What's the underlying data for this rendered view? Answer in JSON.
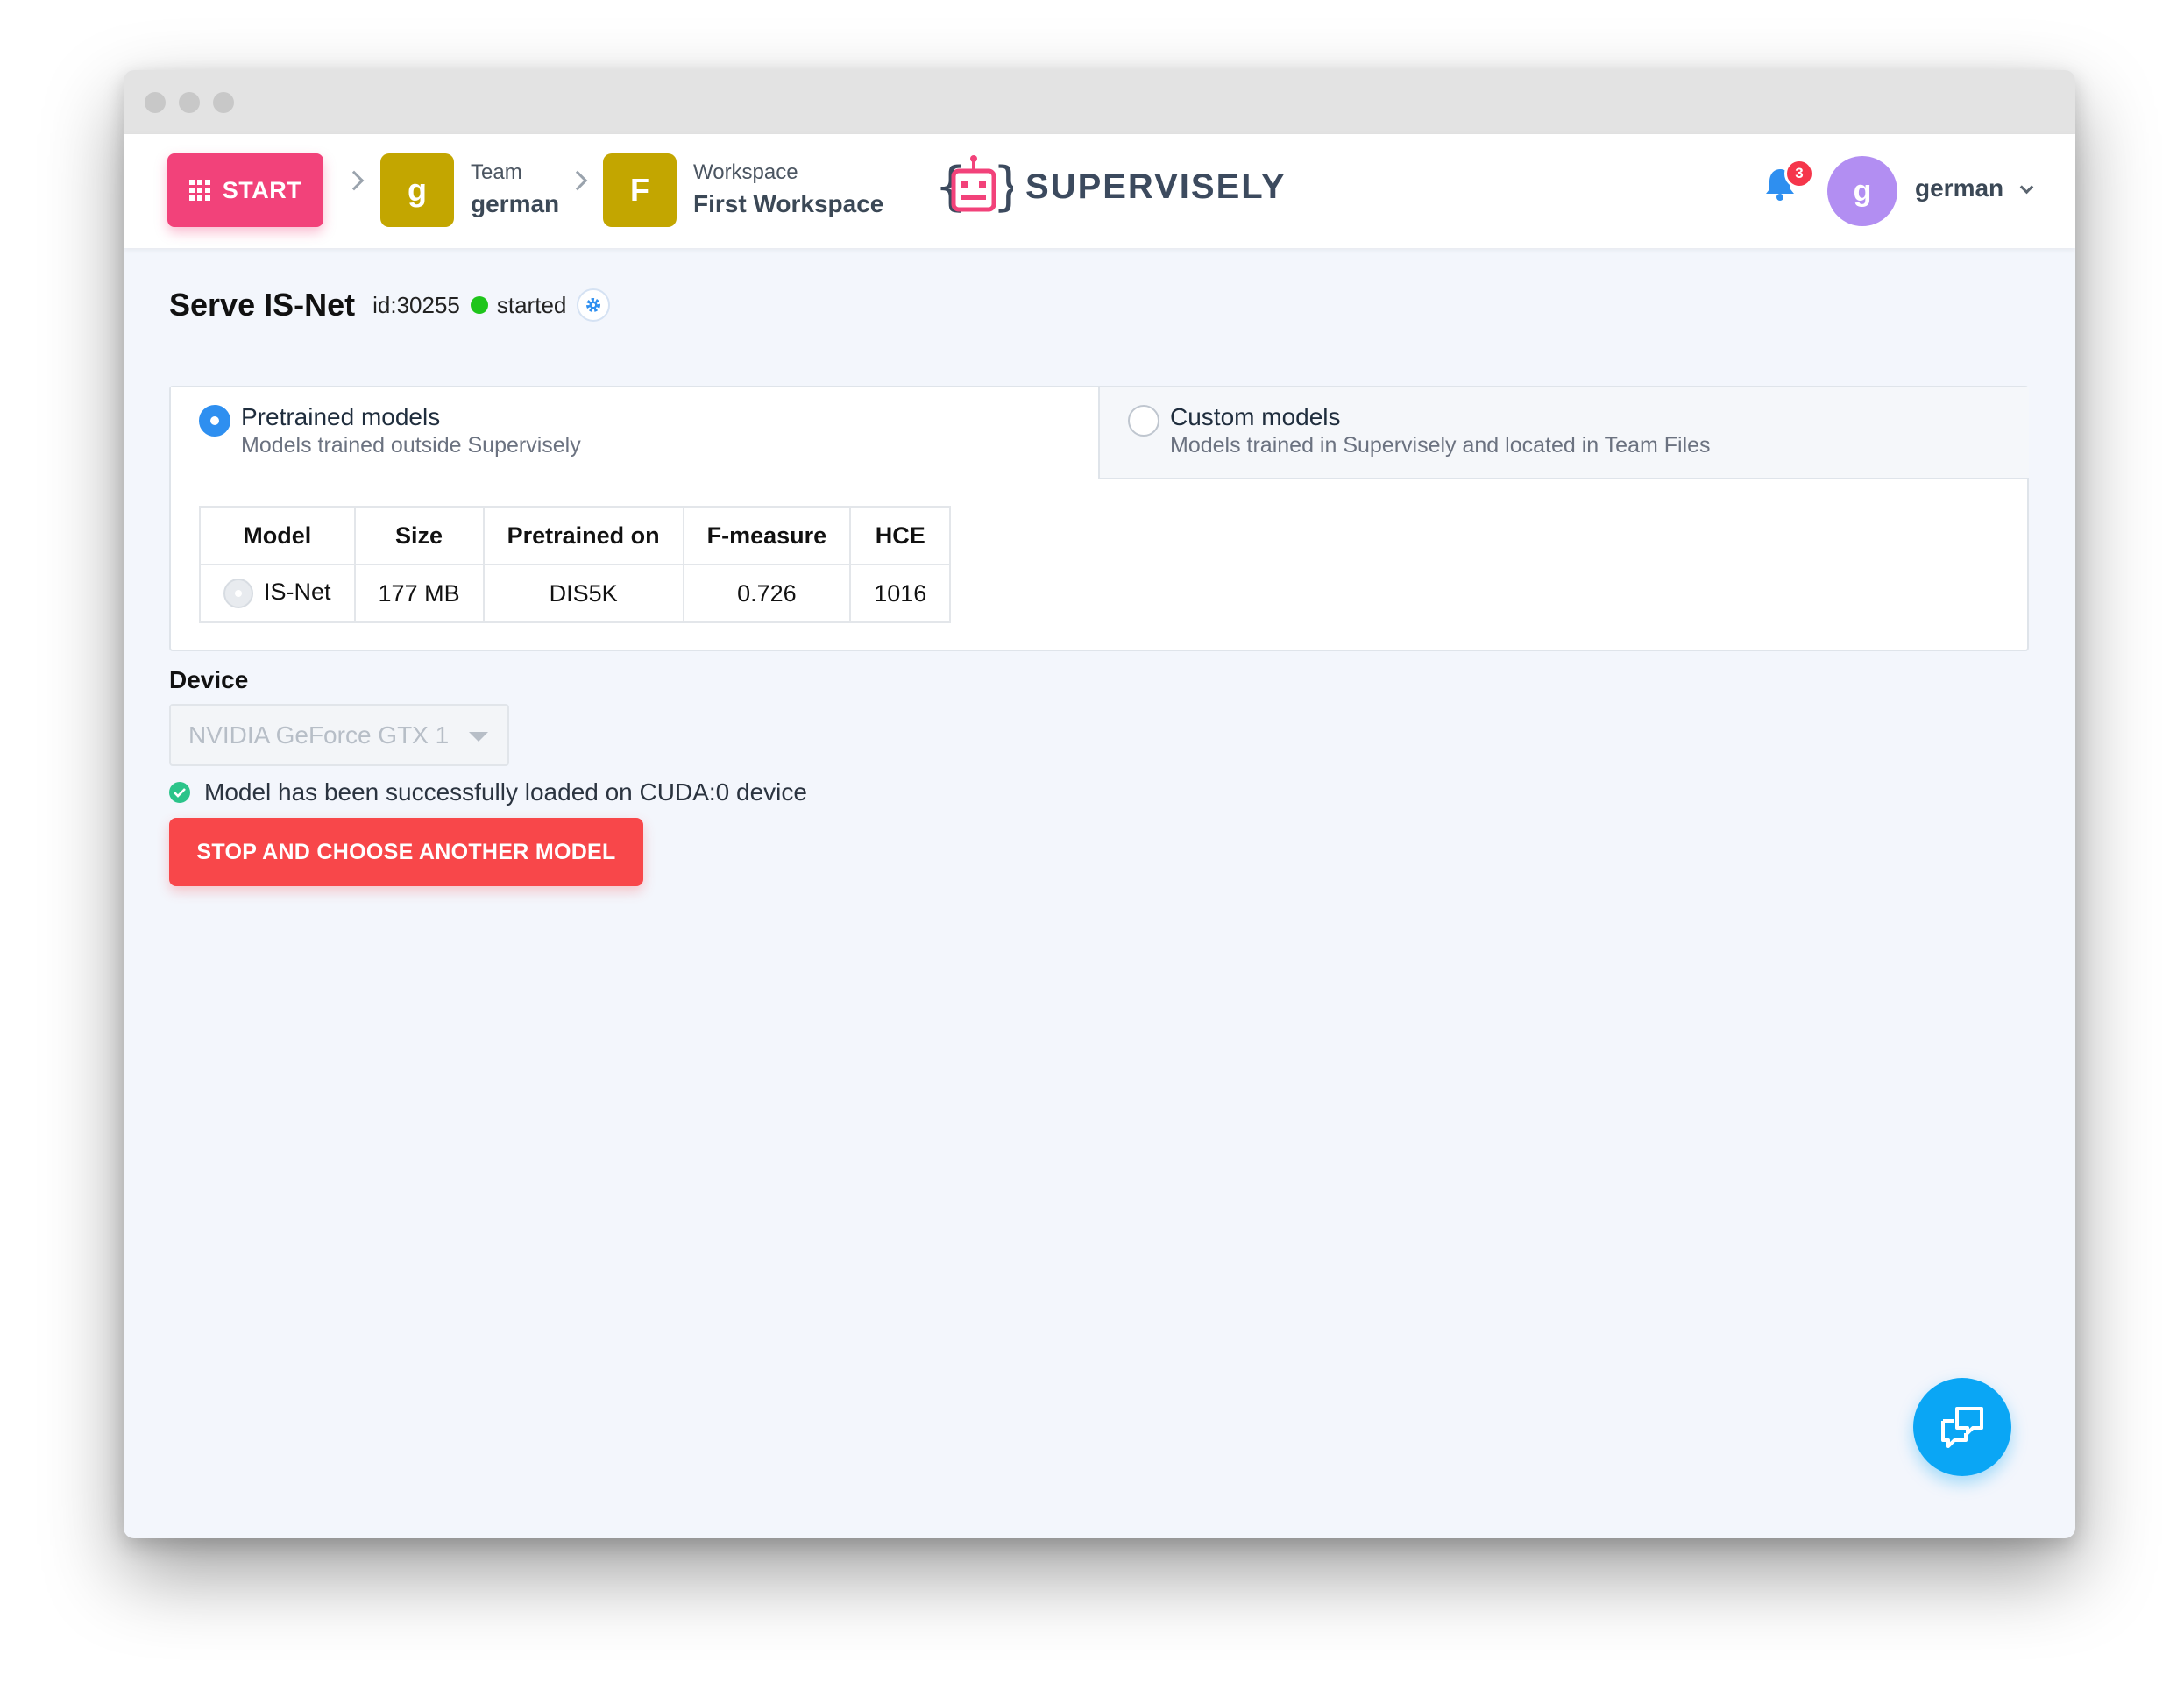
{
  "header": {
    "start_label": "START",
    "team": {
      "avatar_letter": "g",
      "label": "Team",
      "value": "german"
    },
    "workspace": {
      "avatar_letter": "F",
      "label": "Workspace",
      "value": "First Workspace"
    },
    "logo_text": "SUPERVISELY",
    "notifications_count": "3",
    "user": {
      "avatar_letter": "g",
      "name": "german"
    }
  },
  "app": {
    "title": "Serve IS-Net",
    "id": "id:30255",
    "status": "started",
    "status_color": "#1ec51b"
  },
  "tabs": [
    {
      "title": "Pretrained models",
      "subtitle": "Models trained outside Supervisely",
      "selected": true
    },
    {
      "title": "Custom models",
      "subtitle": "Models trained in Supervisely and located in Team Files",
      "selected": false
    }
  ],
  "models_table": {
    "columns": [
      "Model",
      "Size",
      "Pretrained on",
      "F-measure",
      "HCE"
    ],
    "rows": [
      [
        "IS-Net",
        "177 MB",
        "DIS5K",
        "0.726",
        "1016"
      ]
    ]
  },
  "device": {
    "label": "Device",
    "selected": "NVIDIA GeForce GTX 1"
  },
  "status_message": "Model has been successfully loaded on CUDA:0 device",
  "stop_button_label": "STOP AND CHOOSE ANOTHER MODEL",
  "colors": {
    "start": "#f2427a",
    "crumb_avatar": "#c3a600",
    "user_avatar": "#b28ef2",
    "radio_selected": "#2e8ff0",
    "stop_button": "#f8474a",
    "success": "#2bc48a",
    "chat_button": "#0aa6f5",
    "badge": "#f5364b"
  },
  "icons": [
    "grid-icon",
    "chevron-right-icon",
    "robot-logo-icon",
    "bell-icon",
    "chevron-down-icon",
    "gear-icon",
    "check-circle-icon",
    "chat-icon"
  ]
}
